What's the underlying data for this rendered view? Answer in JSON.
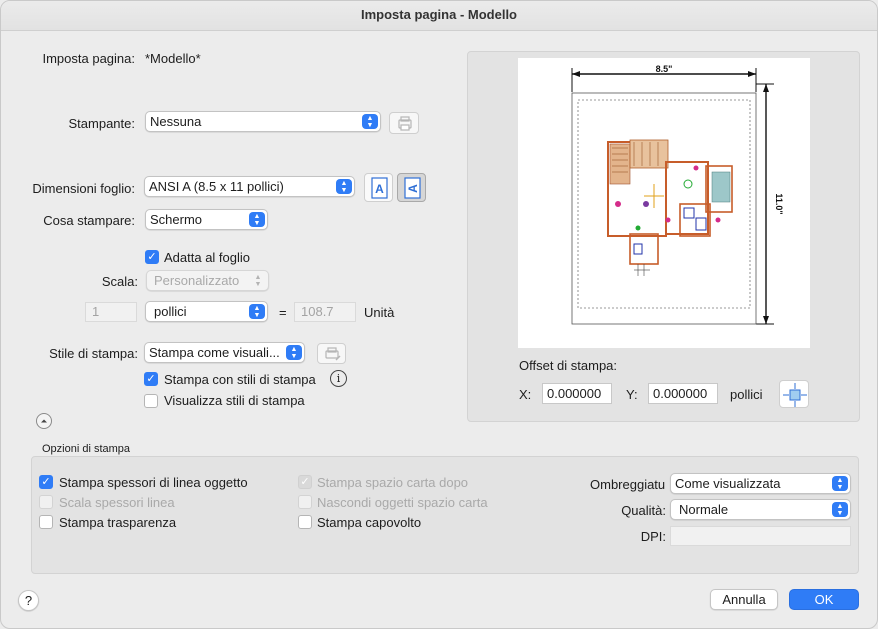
{
  "window": {
    "title": "Imposta pagina - Modello"
  },
  "page_setup": {
    "label": "Imposta pagina:",
    "value": "*Modello*"
  },
  "printer": {
    "label": "Stampante:",
    "value": "Nessuna"
  },
  "paper_size": {
    "label": "Dimensioni foglio:",
    "value": "ANSI A (8.5 x 11 pollici)"
  },
  "what_to_print": {
    "label": "Cosa stampare:",
    "value": "Schermo"
  },
  "fit_to_paper": {
    "label": "Adatta al foglio",
    "checked": true
  },
  "scale": {
    "label": "Scala:",
    "value": "Personalizzato",
    "paper_value": "1",
    "unit": "pollici",
    "equals": "=",
    "drawing_value": "108.7",
    "units_label": "Unità"
  },
  "plot_style": {
    "label": "Stile di stampa:",
    "value": "Stampa come visuali...",
    "with_styles_label": "Stampa con stili di stampa",
    "with_styles_checked": true,
    "display_styles_label": "Visualizza stili di stampa",
    "display_styles_checked": false
  },
  "preview": {
    "width_label": "8.5\"",
    "height_label": "11.0\""
  },
  "offset": {
    "title": "Offset di stampa:",
    "x_label": "X:",
    "x_value": "0.000000",
    "y_label": "Y:",
    "y_value": "0.000000",
    "unit": "pollici"
  },
  "options": {
    "title": "Opzioni di stampa",
    "lineweights": {
      "label": "Stampa spessori di linea oggetto",
      "checked": true,
      "enabled": true
    },
    "scale_lineweights": {
      "label": "Scala spessori linea",
      "checked": false,
      "enabled": false
    },
    "transparency": {
      "label": "Stampa trasparenza",
      "checked": false,
      "enabled": true
    },
    "paperspace_last": {
      "label": "Stampa spazio carta dopo",
      "checked": true,
      "enabled": false
    },
    "hide_paperspace": {
      "label": "Nascondi oggetti spazio carta",
      "checked": false,
      "enabled": false
    },
    "upside_down": {
      "label": "Stampa capovolto",
      "checked": false,
      "enabled": true
    },
    "shading": {
      "label": "Ombreggiatu",
      "value": "Come visualizzata"
    },
    "quality": {
      "label": "Qualità:",
      "value": "Normale"
    },
    "dpi": {
      "label": "DPI:",
      "value": ""
    }
  },
  "buttons": {
    "help": "?",
    "cancel": "Annulla",
    "ok": "OK"
  },
  "colors": {
    "accent": "#2f7cf6",
    "panel": "#e3e3e3",
    "window": "#ececec"
  }
}
